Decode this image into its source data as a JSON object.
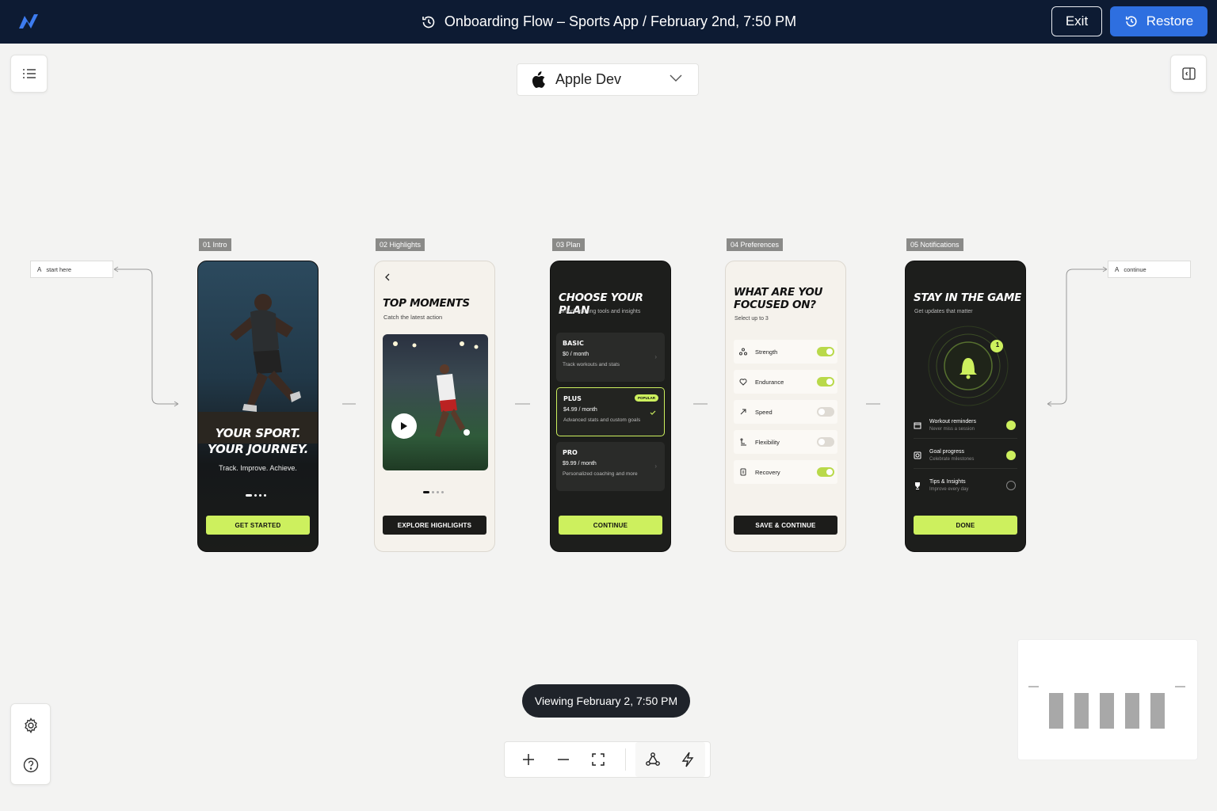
{
  "header": {
    "title": "Onboarding Flow – Sports App / February 2nd, 7:50 PM",
    "exit_label": "Exit",
    "restore_label": "Restore",
    "bg": "#0d1b33",
    "accent": "#2e6fe0"
  },
  "workspace": {
    "selected": "Apple Dev",
    "icon": "apple-icon"
  },
  "stickies": {
    "left": "start here",
    "right": "continue"
  },
  "frames": [
    {
      "tag": "01 Intro",
      "title_line1": "YOUR SPORT.",
      "title_line2": "YOUR JOURNEY.",
      "subtitle": "Track. Improve. Achieve.",
      "cta": "GET STARTED"
    },
    {
      "tag": "02 Highlights",
      "title": "TOP MOMENTS",
      "subtitle": "Catch the latest action",
      "cta": "EXPLORE HIGHLIGHTS"
    },
    {
      "tag": "03 Plan",
      "title": "CHOOSE YOUR PLAN",
      "subtitle": "Unlock training tools and insights",
      "plans": [
        {
          "name": "BASIC",
          "price": "$0",
          "period": " / month",
          "desc": "Track workouts and stats"
        },
        {
          "name": "PLUS",
          "price": "$4.99",
          "period": " / month",
          "desc": "Advanced stats and custom goals",
          "badge": "POPULAR"
        },
        {
          "name": "PRO",
          "price": "$9.99",
          "period": " / month",
          "desc": "Personalized coaching and more"
        }
      ],
      "cta": "CONTINUE"
    },
    {
      "tag": "04 Preferences",
      "title_line1": "WHAT ARE YOU",
      "title_line2": "FOCUSED ON?",
      "subtitle": "Select up to 3",
      "prefs": [
        {
          "label": "Strength",
          "on": true
        },
        {
          "label": "Endurance",
          "on": true
        },
        {
          "label": "Speed",
          "on": false
        },
        {
          "label": "Flexibility",
          "on": false
        },
        {
          "label": "Recovery",
          "on": true
        }
      ],
      "cta": "SAVE & CONTINUE"
    },
    {
      "tag": "05 Notifications",
      "title": "STAY IN THE GAME",
      "subtitle": "Get updates that matter",
      "badge_count": "1",
      "items": [
        {
          "title": "Workout reminders",
          "desc": "Never miss a session",
          "on": true
        },
        {
          "title": "Goal progress",
          "desc": "Celebrate milestones",
          "on": true
        },
        {
          "title": "Tips & Insights",
          "desc": "Improve every day",
          "on": false
        }
      ],
      "cta": "DONE"
    }
  ],
  "viewing_pill": "Viewing February 2, 7:50 PM",
  "colors": {
    "lime": "#cdf05e",
    "canvas": "#f3f3f2"
  }
}
